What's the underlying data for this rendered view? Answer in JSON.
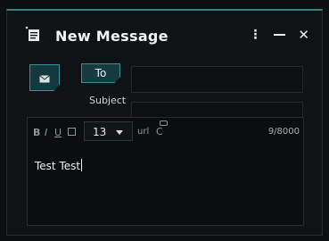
{
  "window": {
    "title": "New Message",
    "icons": {
      "title": "message-icon",
      "more": "more-vertical-icon",
      "minimize": "minimize-icon",
      "close": "close-icon"
    },
    "controls": {
      "more": "⋮",
      "close": "✕"
    }
  },
  "compose": {
    "mail_icon": "envelope-icon",
    "to_label": "To",
    "to_value": "",
    "subject_label": "Subject",
    "subject_value": ""
  },
  "toolbar": {
    "bold": "B",
    "italic": "I",
    "underline": "U",
    "font_size": "13",
    "url": "url",
    "link": "C",
    "counter": "9/8000"
  },
  "body": {
    "text": "Test Test"
  },
  "colors": {
    "accent": "#3c8e98",
    "background": "#101315"
  }
}
